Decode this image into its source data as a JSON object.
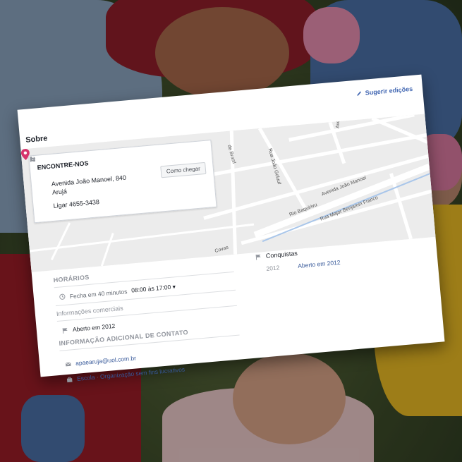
{
  "header": {
    "suggest_edits": "Sugerir edições",
    "section_title": "Sobre"
  },
  "map": {
    "streets": [
      "Rua João Goluuf",
      "Avenida Armando Co",
      "Avenida João Manoel",
      "Rio Baquirivu",
      "Rua Major Benjamin Franco",
      "Covas",
      "de Brasil"
    ]
  },
  "find_us": {
    "title": "ENCONTRE-NOS",
    "address_line1": "Avenida João Manoel, 840",
    "address_line2": "Arujá",
    "phone": "Ligar 4655-3438",
    "directions_button": "Como chegar"
  },
  "hours": {
    "title": "HORÁRIOS",
    "status": "Fecha em 40 minutos",
    "range": "08:00 às 17:00 ▾"
  },
  "business_info": {
    "title": "Informações comerciais",
    "founded": "Aberto em 2012"
  },
  "contact": {
    "title": "INFORMAÇÃO ADICIONAL DE CONTATO",
    "email": "apaearuja@uol.com.br",
    "category_prefix": "Escola",
    "category_sep": " · ",
    "category_link": "Organização sem fins lucrativos"
  },
  "achievements": {
    "title": "Conquistas",
    "year": "2012",
    "label": "Aberto em 2012"
  },
  "colors": {
    "link": "#365899",
    "accent": "#4267b2",
    "pin": "#d6336c"
  }
}
